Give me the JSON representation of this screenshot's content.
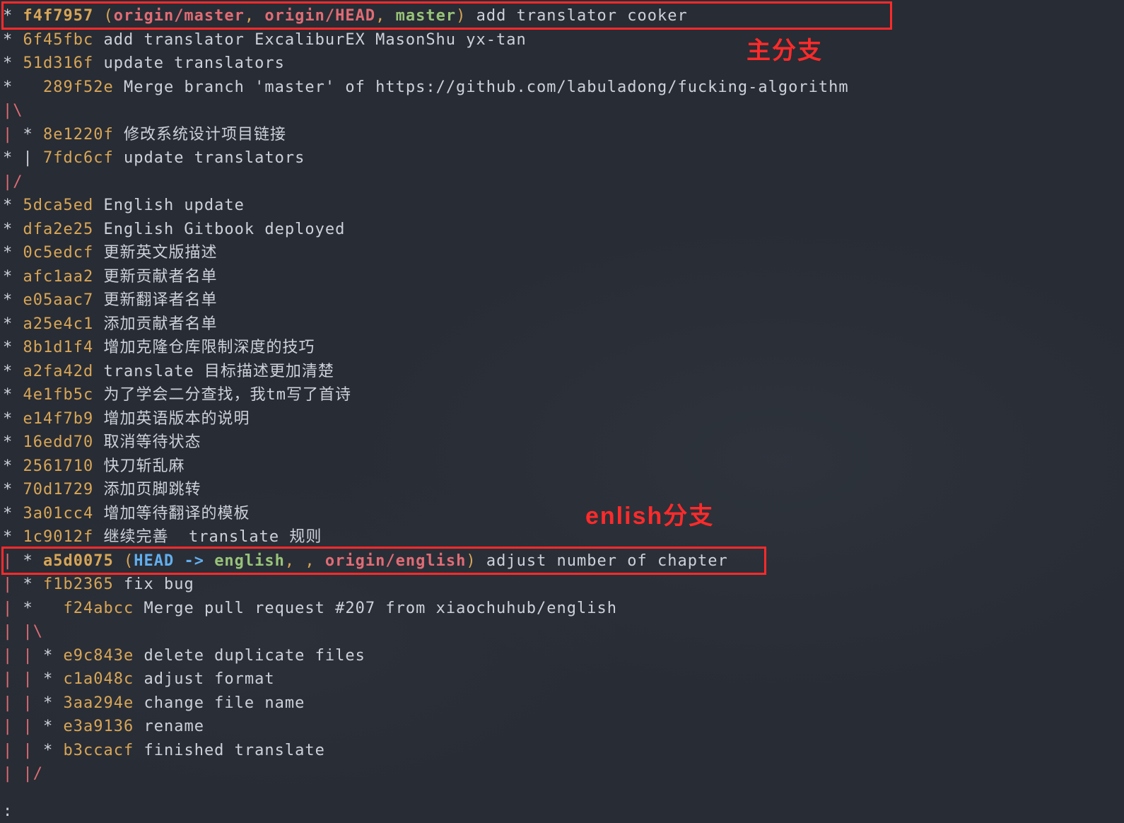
{
  "colors": {
    "bg": "#282c34",
    "fg": "#cdd1d9",
    "hash": "#d8a657",
    "remote": "#e06c75",
    "local": "#98c379",
    "head": "#61afef",
    "annotation": "#ff2a2a"
  },
  "annotation_main": "主分支",
  "annotation_english": "enlish分支",
  "prompt_char": ":",
  "lines": [
    {
      "graph": "* ",
      "hash": "f4f7957",
      "refs": [
        {
          "t": "remote",
          "v": "origin/master"
        },
        {
          "t": "remote",
          "v": "origin/HEAD"
        },
        {
          "t": "local",
          "v": "master"
        }
      ],
      "msg": "add translator cooker"
    },
    {
      "graph": "* ",
      "hash": "6f45fbc",
      "msg": "add translator ExcaliburEX MasonShu yx-tan"
    },
    {
      "graph": "* ",
      "hash": "51d316f",
      "msg": "update translators"
    },
    {
      "graph": "*   ",
      "hash": "289f52e",
      "msg": "Merge branch 'master' of https://github.com/labuladong/fucking-algorithm"
    },
    {
      "graph": "|\\"
    },
    {
      "graph": "| * ",
      "hash": "8e1220f",
      "msg": "修改系统设计项目链接"
    },
    {
      "graph": "* | ",
      "hash": "7fdc6cf",
      "msg": "update translators"
    },
    {
      "graph": "|/"
    },
    {
      "graph": "* ",
      "hash": "5dca5ed",
      "msg": "English update"
    },
    {
      "graph": "* ",
      "hash": "dfa2e25",
      "msg": "English Gitbook deployed"
    },
    {
      "graph": "* ",
      "hash": "0c5edcf",
      "msg": "更新英文版描述"
    },
    {
      "graph": "* ",
      "hash": "afc1aa2",
      "msg": "更新贡献者名单"
    },
    {
      "graph": "* ",
      "hash": "e05aac7",
      "msg": "更新翻译者名单"
    },
    {
      "graph": "* ",
      "hash": "a25e4c1",
      "msg": "添加贡献者名单"
    },
    {
      "graph": "* ",
      "hash": "8b1d1f4",
      "msg": "增加克隆仓库限制深度的技巧"
    },
    {
      "graph": "* ",
      "hash": "a2fa42d",
      "msg": "translate 目标描述更加清楚"
    },
    {
      "graph": "* ",
      "hash": "4e1fb5c",
      "msg": "为了学会二分查找，我tm写了首诗"
    },
    {
      "graph": "* ",
      "hash": "e14f7b9",
      "msg": "增加英语版本的说明"
    },
    {
      "graph": "* ",
      "hash": "16edd70",
      "msg": "取消等待状态"
    },
    {
      "graph": "* ",
      "hash": "2561710",
      "msg": "快刀斩乱麻"
    },
    {
      "graph": "* ",
      "hash": "70d1729",
      "msg": "添加页脚跳转"
    },
    {
      "graph": "* ",
      "hash": "3a01cc4",
      "msg": "增加等待翻译的模板"
    },
    {
      "graph": "* ",
      "hash": "1c9012f",
      "msg": "继续完善  translate 规则"
    },
    {
      "graph": "| * ",
      "hash": "a5d0075",
      "refs": [
        {
          "t": "head",
          "v": "HEAD"
        },
        {
          "t": "arrow",
          "v": " -> "
        },
        {
          "t": "local",
          "v": "english"
        },
        {
          "t": "remote",
          "v": "origin/english"
        }
      ],
      "msg": "adjust number of chapter"
    },
    {
      "graph": "| * ",
      "hash": "f1b2365",
      "msg": "fix bug"
    },
    {
      "graph": "| *   ",
      "hash": "f24abcc",
      "msg": "Merge pull request #207 from xiaochuhub/english"
    },
    {
      "graph": "| |\\"
    },
    {
      "graph": "| | * ",
      "hash": "e9c843e",
      "msg": "delete duplicate files"
    },
    {
      "graph": "| | * ",
      "hash": "c1a048c",
      "msg": "adjust format"
    },
    {
      "graph": "| | * ",
      "hash": "3aa294e",
      "msg": "change file name"
    },
    {
      "graph": "| | * ",
      "hash": "e3a9136",
      "msg": "rename"
    },
    {
      "graph": "| | * ",
      "hash": "b3ccacf",
      "msg": "finished translate"
    },
    {
      "graph": "| |/"
    }
  ]
}
